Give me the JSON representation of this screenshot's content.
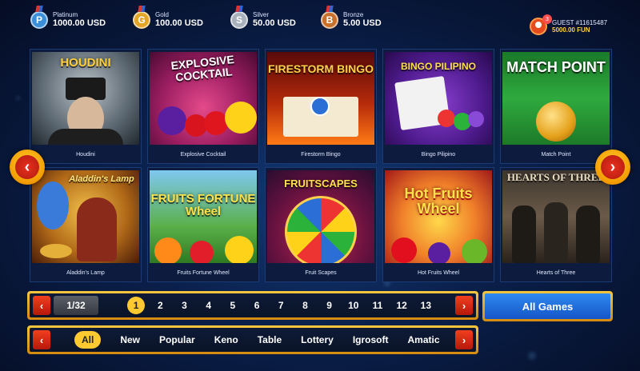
{
  "jackpots": [
    {
      "name": "Platinum",
      "amount": "1000.00 USD",
      "badge": "P",
      "color": "#3a8fd8"
    },
    {
      "name": "Gold",
      "amount": "100.00 USD",
      "badge": "G",
      "color": "#e2a526"
    },
    {
      "name": "Silver",
      "amount": "50.00 USD",
      "badge": "S",
      "color": "#a9b2bc"
    },
    {
      "name": "Bronze",
      "amount": "5.00 USD",
      "badge": "B",
      "color": "#c8702a"
    }
  ],
  "user": {
    "name": "GUEST #11615487",
    "balance": "5000.00 FUN",
    "badge": "3"
  },
  "games": [
    {
      "label": "Houdini",
      "title": "HOUDINI"
    },
    {
      "label": "Explosive Cocktail",
      "title": "EXPLOSIVE COCKTAIL"
    },
    {
      "label": "Firestorm Bingo",
      "title": "FIRESTORM BINGO"
    },
    {
      "label": "Bingo Pilipino",
      "title": "BINGO PILIPINO"
    },
    {
      "label": "Match Point",
      "title": "MATCH POINT"
    },
    {
      "label": "Aladdin's Lamp",
      "title": "Aladdin's Lamp"
    },
    {
      "label": "Fruits Fortune Wheel",
      "title": "FRUITS FORTUNE Wheel"
    },
    {
      "label": "Fruit Scapes",
      "title": "FRUITSCAPES"
    },
    {
      "label": "Hot Fruits Wheel",
      "title": "Hot Fruits Wheel"
    },
    {
      "label": "Hearts of Three",
      "title": "HEARTS OF THREE"
    }
  ],
  "nav": {
    "prev": "‹",
    "next": "›"
  },
  "pagination": {
    "current": "1/32",
    "pages": [
      "1",
      "2",
      "3",
      "4",
      "5",
      "6",
      "7",
      "8",
      "9",
      "10",
      "11",
      "12",
      "13"
    ],
    "active_index": 0
  },
  "categories": [
    "All",
    "New",
    "Popular",
    "Keno",
    "Table",
    "Lottery",
    "Igrosoft",
    "Amatic"
  ],
  "all_games_label": "All Games",
  "colors": {
    "accent": "#ffc930",
    "button_red": "#d42412",
    "all_games_blue": "#2f8af0"
  }
}
